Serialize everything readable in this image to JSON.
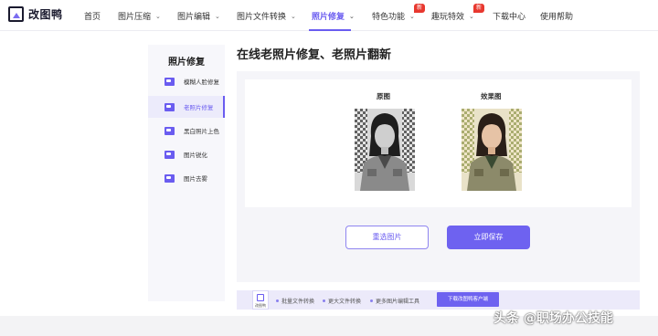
{
  "brand": {
    "name": "改图鸭",
    "accent": "#6a5cf0",
    "badge_color": "#e8382f"
  },
  "nav": {
    "items": [
      {
        "label": "首页",
        "has_menu": false
      },
      {
        "label": "图片压缩",
        "has_menu": true
      },
      {
        "label": "图片编辑",
        "has_menu": true
      },
      {
        "label": "图片文件转换",
        "has_menu": true
      },
      {
        "label": "照片修复",
        "has_menu": true,
        "active": true
      },
      {
        "label": "特色功能",
        "has_menu": true,
        "badge": "新"
      },
      {
        "label": "趣玩特效",
        "has_menu": true,
        "badge": "新"
      },
      {
        "label": "下载中心",
        "has_menu": false
      },
      {
        "label": "使用帮助",
        "has_menu": false
      }
    ]
  },
  "sidebar": {
    "title": "照片修复",
    "items": [
      {
        "label": "模糊人脸修复",
        "icon": "face-image-icon"
      },
      {
        "label": "老照片修复",
        "icon": "photo-repair-icon",
        "active": true
      },
      {
        "label": "黑白照片上色",
        "icon": "colorize-icon"
      },
      {
        "label": "图片锐化",
        "icon": "sharpen-icon"
      },
      {
        "label": "图片去雾",
        "icon": "dehaze-icon"
      }
    ]
  },
  "main": {
    "title": "在线老照片修复、老照片翻新",
    "original_label": "原图",
    "result_label": "效果图",
    "reselect_button": "重选图片",
    "save_button": "立即保存"
  },
  "promo": {
    "logo_text": "改图鸭",
    "features": [
      "批量文件转换",
      "更大文件转换",
      "更多图片编辑工具"
    ],
    "download_button": "下载改图鸭客户端"
  },
  "watermark": "头条 @职场办公技能"
}
